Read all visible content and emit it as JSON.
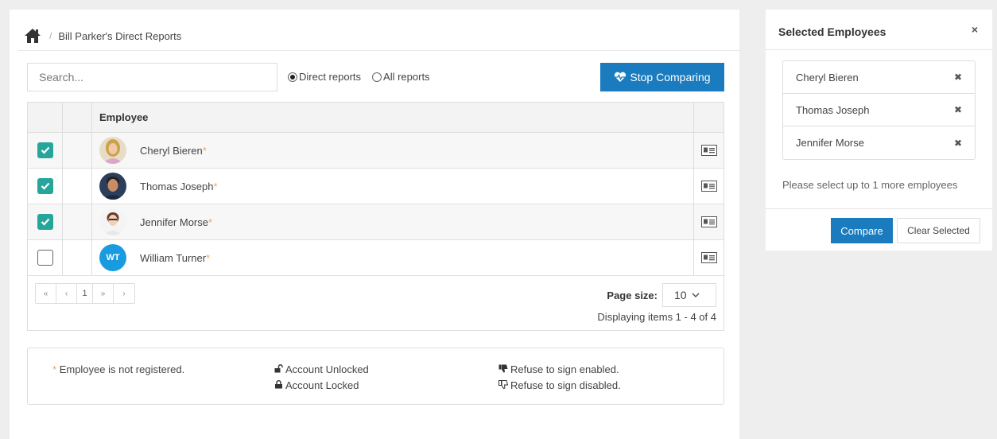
{
  "breadcrumb": {
    "current": "Bill Parker's Direct Reports",
    "separator": "/"
  },
  "search": {
    "placeholder": "Search..."
  },
  "report_filter": {
    "options": [
      "Direct reports",
      "All reports"
    ],
    "selected": "Direct reports"
  },
  "stop_button": {
    "label": "Stop Comparing"
  },
  "grid": {
    "header": {
      "employee": "Employee"
    },
    "rows": [
      {
        "name": "Cheryl Bieren",
        "checked": true,
        "star": "*"
      },
      {
        "name": "Thomas Joseph",
        "checked": true,
        "star": "*"
      },
      {
        "name": "Jennifer Morse",
        "checked": true,
        "star": "*"
      },
      {
        "name": "William Turner",
        "checked": false,
        "initials": "WT",
        "star": "*"
      }
    ],
    "pager": {
      "first": "«",
      "prev": "‹",
      "page": "1",
      "next": "»",
      "last": "›"
    },
    "page_size": {
      "label": "Page size:",
      "value": "10"
    },
    "displaying": "Displaying items 1 - 4 of 4"
  },
  "legend": {
    "star": "*",
    "not_registered": "Employee is not registered.",
    "unlocked": "Account Unlocked",
    "locked": "Account Locked",
    "refuse_enabled": "Refuse to sign enabled.",
    "refuse_disabled": "Refuse to sign disabled."
  },
  "side": {
    "title": "Selected Employees",
    "close": "×",
    "selected": [
      "Cheryl Bieren",
      "Thomas Joseph",
      "Jennifer Morse"
    ],
    "remove": "✖",
    "message": "Please select up to 1 more employees",
    "compare_label": "Compare",
    "clear_label": "Clear Selected"
  },
  "colors": {
    "primary": "#1a7bbf",
    "check": "#26a69a",
    "star": "#f0a35e",
    "initials_bg": "#1a9be0"
  }
}
